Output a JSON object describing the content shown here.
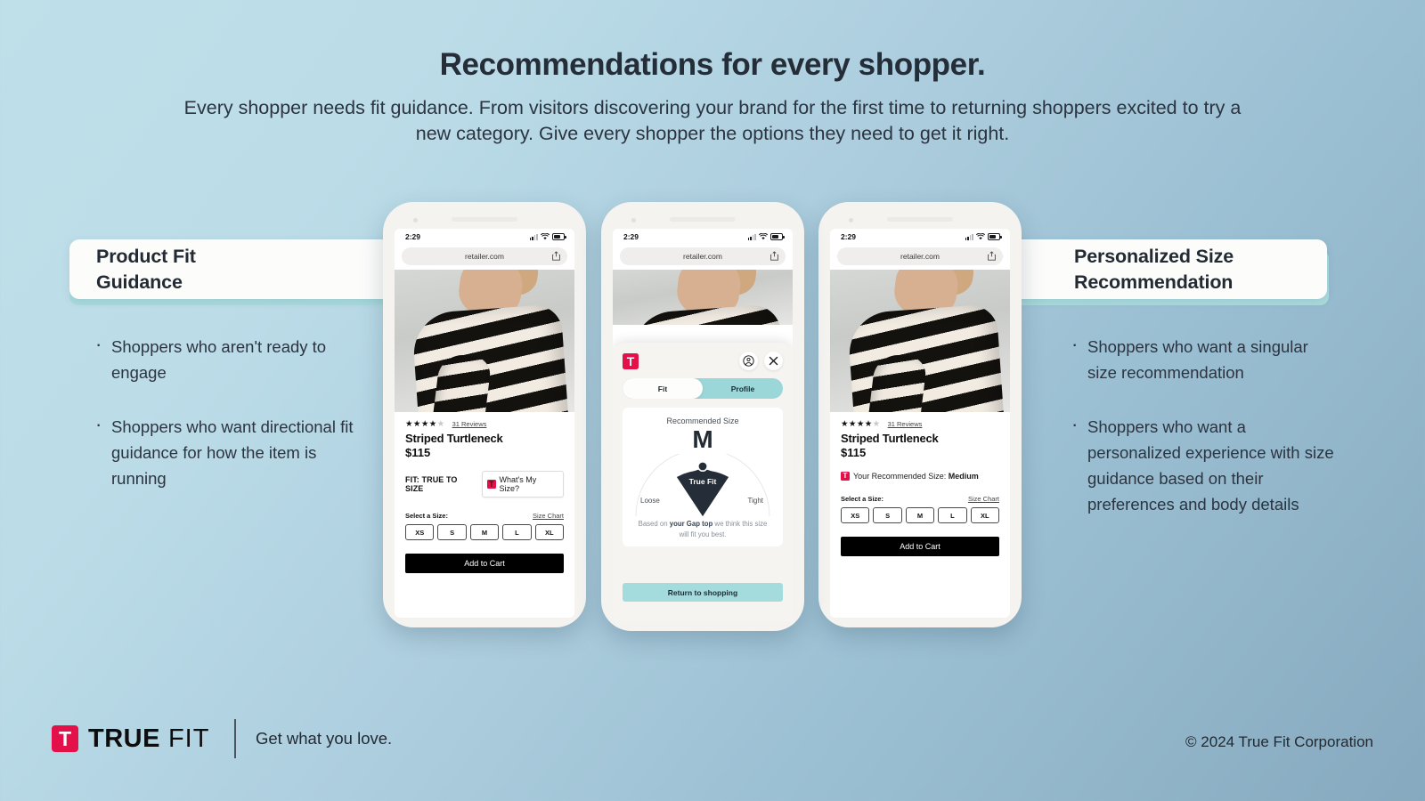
{
  "hero": {
    "title": "Recommendations for every shopper.",
    "subtitle": "Every shopper needs fit guidance. From visitors discovering your brand for the first time to returning shoppers excited to try a new category. Give every shopper the options they need to get it right."
  },
  "columns": {
    "left": {
      "heading": "Product Fit\nGuidance",
      "bullets": [
        "Shoppers who aren't ready to engage",
        "Shoppers who want directional fit guidance for how the item is running"
      ]
    },
    "right": {
      "heading": "Personalized Size\nRecommendation",
      "bullets": [
        "Shoppers who want a singular size recommendation",
        "Shoppers who want a personalized experience with size guidance based on their preferences and body details"
      ]
    }
  },
  "phone": {
    "status_time": "2:29",
    "url": "retailer.com"
  },
  "product": {
    "stars_filled": 4,
    "stars_total": 5,
    "reviews": "31 Reviews",
    "title": "Striped Turtleneck",
    "price": "$115",
    "fit_label": "FIT: TRUE TO SIZE",
    "whats_my_size": "What's My Size?",
    "rec_prefix": "Your Recommended Size:",
    "rec_value": "Medium",
    "select_size_label": "Select a Size:",
    "size_chart_label": "Size Chart",
    "sizes": [
      "XS",
      "S",
      "M",
      "L",
      "XL"
    ],
    "add_to_cart": "Add to Cart",
    "tf_letter": "T"
  },
  "modal": {
    "logo_letter": "T",
    "tabs": [
      {
        "label": "Fit",
        "active": true
      },
      {
        "label": "Profile",
        "active": false
      }
    ],
    "recommended_label": "Recommended Size",
    "recommended_size": "M",
    "gauge": {
      "center_label": "True Fit",
      "left_label": "Loose",
      "right_label": "Tight"
    },
    "basis_pre": "Based on ",
    "basis_bold": "your Gap top",
    "basis_post": " we think this size will fit you best.",
    "return_button": "Return to shopping"
  },
  "footer": {
    "logo_letter": "T",
    "logo_true": "TRUE",
    "logo_fit": "FIT",
    "tagline": "Get what you love.",
    "copyright": "© 2024 True Fit Corporation"
  },
  "colors": {
    "brand_red": "#e4104a",
    "teal_band": "#a9dbdd",
    "mint_tab": "#9bd7d9",
    "text_dark": "#222a33"
  }
}
